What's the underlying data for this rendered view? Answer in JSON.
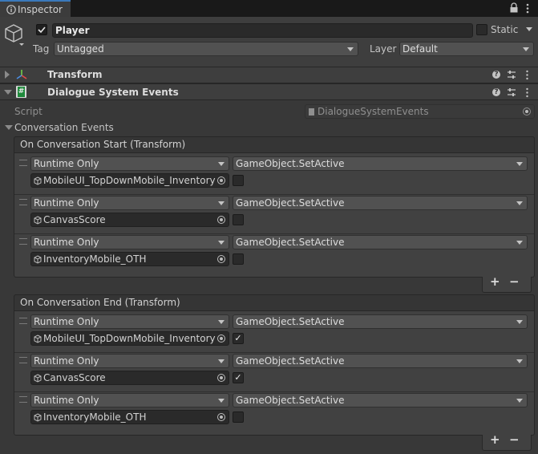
{
  "tab": {
    "label": "Inspector"
  },
  "header": {
    "name": "Player",
    "static_label": "Static",
    "tag_label": "Tag",
    "tag_value": "Untagged",
    "layer_label": "Layer",
    "layer_value": "Default",
    "active": true,
    "static": false
  },
  "components": {
    "transform": {
      "title": "Transform",
      "expanded": false
    },
    "dse": {
      "title": "Dialogue System Events",
      "expanded": true,
      "icon": "#"
    }
  },
  "script": {
    "label": "Script",
    "value": "DialogueSystemEvents"
  },
  "conversation_events": {
    "label": "Conversation Events"
  },
  "events": [
    {
      "title": "On Conversation Start (Transform)",
      "entries": [
        {
          "mode": "Runtime Only",
          "function": "GameObject.SetActive",
          "target": "MobileUI_TopDownMobile_Inventory",
          "value": false
        },
        {
          "mode": "Runtime Only",
          "function": "GameObject.SetActive",
          "target": "CanvasScore",
          "value": false
        },
        {
          "mode": "Runtime Only",
          "function": "GameObject.SetActive",
          "target": "InventoryMobile_OTH",
          "value": false
        }
      ]
    },
    {
      "title": "On Conversation End (Transform)",
      "entries": [
        {
          "mode": "Runtime Only",
          "function": "GameObject.SetActive",
          "target": "MobileUI_TopDownMobile_Inventory",
          "value": true
        },
        {
          "mode": "Runtime Only",
          "function": "GameObject.SetActive",
          "target": "CanvasScore",
          "value": true
        },
        {
          "mode": "Runtime Only",
          "function": "GameObject.SetActive",
          "target": "InventoryMobile_OTH",
          "value": false
        }
      ]
    }
  ],
  "buttons": {
    "plus": "+",
    "minus": "−"
  },
  "check_glyph": "✓"
}
